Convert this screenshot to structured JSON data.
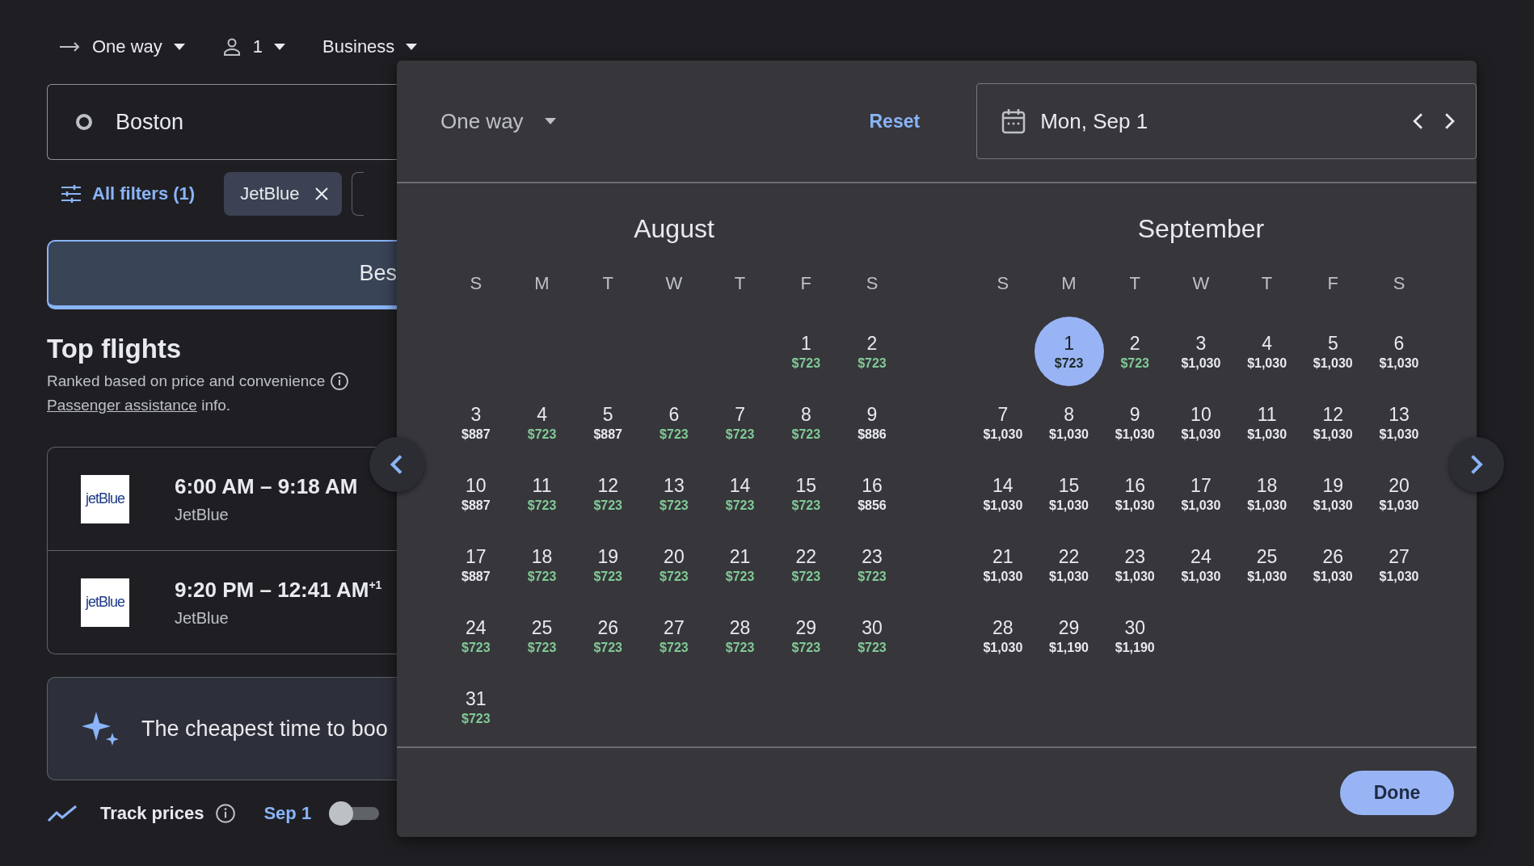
{
  "top_bar": {
    "trip_type": "One way",
    "passengers": "1",
    "cabin_class": "Business"
  },
  "search": {
    "origin": "Boston"
  },
  "filters": {
    "all_filters": "All filters (1)",
    "chips": [
      "JetBlue"
    ]
  },
  "sort_tabs": [
    {
      "label": "Bes",
      "selected": true
    }
  ],
  "top_flights": {
    "title": "Top flights",
    "subtitle": "Ranked based on price and convenience",
    "link": "Passenger assistance",
    "link_suffix": " info."
  },
  "flights": [
    {
      "logo": "jetBlue",
      "times": "6:00 AM – 9:18 AM",
      "airline": "JetBlue"
    },
    {
      "logo": "jetBlue",
      "times": "9:20 PM – 12:41 AM",
      "day_offset": "+1",
      "airline": "JetBlue"
    }
  ],
  "insight": {
    "text": "The cheapest time to boo"
  },
  "track_prices": {
    "label": "Track prices",
    "date": "Sep 1",
    "on": false
  },
  "calendar": {
    "trip_type": "One way",
    "reset": "Reset",
    "date": "Mon, Sep 1",
    "months": [
      {
        "name": "August",
        "weekdays": [
          "S",
          "M",
          "T",
          "W",
          "T",
          "F",
          "S"
        ],
        "weeks": [
          [
            {
              "day": "1",
              "price": "$723",
              "cheap": true,
              "selected": false
            },
            {
              "day": "2",
              "price": "$723",
              "cheap": true,
              "selected": false
            }
          ],
          [
            {
              "day": "3",
              "price": "$887",
              "cheap": false,
              "selected": false
            },
            {
              "day": "4",
              "price": "$723",
              "cheap": true,
              "selected": false
            },
            {
              "day": "5",
              "price": "$887",
              "cheap": false,
              "selected": false
            },
            {
              "day": "6",
              "price": "$723",
              "cheap": true,
              "selected": false
            },
            {
              "day": "7",
              "price": "$723",
              "cheap": true,
              "selected": false
            },
            {
              "day": "8",
              "price": "$723",
              "cheap": true,
              "selected": false
            },
            {
              "day": "9",
              "price": "$886",
              "cheap": false,
              "selected": false
            }
          ],
          [
            {
              "day": "10",
              "price": "$887",
              "cheap": false,
              "selected": false
            },
            {
              "day": "11",
              "price": "$723",
              "cheap": true,
              "selected": false
            },
            {
              "day": "12",
              "price": "$723",
              "cheap": true,
              "selected": false
            },
            {
              "day": "13",
              "price": "$723",
              "cheap": true,
              "selected": false
            },
            {
              "day": "14",
              "price": "$723",
              "cheap": true,
              "selected": false
            },
            {
              "day": "15",
              "price": "$723",
              "cheap": true,
              "selected": false
            },
            {
              "day": "16",
              "price": "$856",
              "cheap": false,
              "selected": false
            }
          ],
          [
            {
              "day": "17",
              "price": "$887",
              "cheap": false,
              "selected": false
            },
            {
              "day": "18",
              "price": "$723",
              "cheap": true,
              "selected": false
            },
            {
              "day": "19",
              "price": "$723",
              "cheap": true,
              "selected": false
            },
            {
              "day": "20",
              "price": "$723",
              "cheap": true,
              "selected": false
            },
            {
              "day": "21",
              "price": "$723",
              "cheap": true,
              "selected": false
            },
            {
              "day": "22",
              "price": "$723",
              "cheap": true,
              "selected": false
            },
            {
              "day": "23",
              "price": "$723",
              "cheap": true,
              "selected": false
            }
          ],
          [
            {
              "day": "24",
              "price": "$723",
              "cheap": true,
              "selected": false
            },
            {
              "day": "25",
              "price": "$723",
              "cheap": true,
              "selected": false
            },
            {
              "day": "26",
              "price": "$723",
              "cheap": true,
              "selected": false
            },
            {
              "day": "27",
              "price": "$723",
              "cheap": true,
              "selected": false
            },
            {
              "day": "28",
              "price": "$723",
              "cheap": true,
              "selected": false
            },
            {
              "day": "29",
              "price": "$723",
              "cheap": true,
              "selected": false
            },
            {
              "day": "30",
              "price": "$723",
              "cheap": true,
              "selected": false
            }
          ],
          [
            {
              "day": "31",
              "price": "$723",
              "cheap": true,
              "selected": false
            }
          ]
        ]
      },
      {
        "name": "September",
        "weekdays": [
          "S",
          "M",
          "T",
          "W",
          "T",
          "F",
          "S"
        ],
        "weeks": [
          [
            {
              "day": "1",
              "price": "$723",
              "cheap": true,
              "selected": true
            },
            {
              "day": "2",
              "price": "$723",
              "cheap": true,
              "selected": false
            },
            {
              "day": "3",
              "price": "$1,030",
              "cheap": false,
              "selected": false
            },
            {
              "day": "4",
              "price": "$1,030",
              "cheap": false,
              "selected": false
            },
            {
              "day": "5",
              "price": "$1,030",
              "cheap": false,
              "selected": false
            },
            {
              "day": "6",
              "price": "$1,030",
              "cheap": false,
              "selected": false
            }
          ],
          [
            {
              "day": "7",
              "price": "$1,030",
              "cheap": false,
              "selected": false
            },
            {
              "day": "8",
              "price": "$1,030",
              "cheap": false,
              "selected": false
            },
            {
              "day": "9",
              "price": "$1,030",
              "cheap": false,
              "selected": false
            },
            {
              "day": "10",
              "price": "$1,030",
              "cheap": false,
              "selected": false
            },
            {
              "day": "11",
              "price": "$1,030",
              "cheap": false,
              "selected": false
            },
            {
              "day": "12",
              "price": "$1,030",
              "cheap": false,
              "selected": false
            },
            {
              "day": "13",
              "price": "$1,030",
              "cheap": false,
              "selected": false
            }
          ],
          [
            {
              "day": "14",
              "price": "$1,030",
              "cheap": false,
              "selected": false
            },
            {
              "day": "15",
              "price": "$1,030",
              "cheap": false,
              "selected": false
            },
            {
              "day": "16",
              "price": "$1,030",
              "cheap": false,
              "selected": false
            },
            {
              "day": "17",
              "price": "$1,030",
              "cheap": false,
              "selected": false
            },
            {
              "day": "18",
              "price": "$1,030",
              "cheap": false,
              "selected": false
            },
            {
              "day": "19",
              "price": "$1,030",
              "cheap": false,
              "selected": false
            },
            {
              "day": "20",
              "price": "$1,030",
              "cheap": false,
              "selected": false
            }
          ],
          [
            {
              "day": "21",
              "price": "$1,030",
              "cheap": false,
              "selected": false
            },
            {
              "day": "22",
              "price": "$1,030",
              "cheap": false,
              "selected": false
            },
            {
              "day": "23",
              "price": "$1,030",
              "cheap": false,
              "selected": false
            },
            {
              "day": "24",
              "price": "$1,030",
              "cheap": false,
              "selected": false
            },
            {
              "day": "25",
              "price": "$1,030",
              "cheap": false,
              "selected": false
            },
            {
              "day": "26",
              "price": "$1,030",
              "cheap": false,
              "selected": false
            },
            {
              "day": "27",
              "price": "$1,030",
              "cheap": false,
              "selected": false
            }
          ],
          [
            {
              "day": "28",
              "price": "$1,030",
              "cheap": false,
              "selected": false
            },
            {
              "day": "29",
              "price": "$1,190",
              "cheap": false,
              "selected": false
            },
            {
              "day": "30",
              "price": "$1,190",
              "cheap": false,
              "selected": false
            }
          ]
        ]
      }
    ],
    "done": "Done"
  }
}
